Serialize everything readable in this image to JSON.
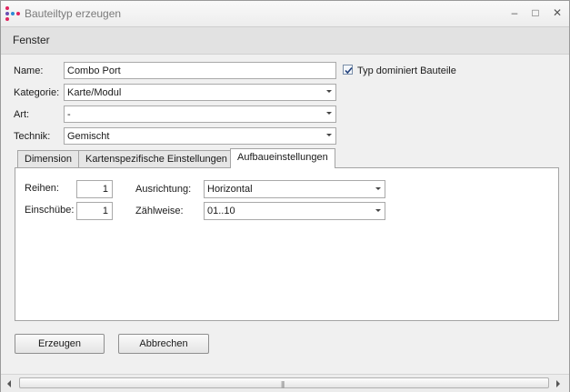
{
  "window": {
    "title": "Bauteiltyp erzeugen",
    "minimize": "–",
    "maximize": "□",
    "close": "✕"
  },
  "ribbon": {
    "label": "Fenster"
  },
  "form": {
    "name_label": "Name:",
    "name_value": "Combo Port",
    "checkbox_label": "Typ dominiert Bauteile",
    "checkbox_checked": true,
    "kategorie_label": "Kategorie:",
    "kategorie_value": "Karte/Modul",
    "art_label": "Art:",
    "art_value": "-",
    "technik_label": "Technik:",
    "technik_value": "Gemischt"
  },
  "tabs": [
    {
      "label": "Dimension",
      "active": false
    },
    {
      "label": "Kartenspezifische Einstellungen",
      "active": false
    },
    {
      "label": "Aufbaueinstellungen",
      "active": true
    }
  ],
  "panel": {
    "reihen_label": "Reihen:",
    "reihen_value": "1",
    "einschuebe_label": "Einschübe:",
    "einschuebe_value": "1",
    "ausrichtung_label": "Ausrichtung:",
    "ausrichtung_value": "Horizontal",
    "zaehlweise_label": "Zählweise:",
    "zaehlweise_value": "01..10"
  },
  "buttons": {
    "create": "Erzeugen",
    "cancel": "Abbrechen"
  },
  "scrollbar": {
    "grip": "|||"
  },
  "colors": {
    "icon_dots": [
      "#e0245e",
      "#6a4fb3",
      "#2d8bd6",
      "#e0245e"
    ]
  }
}
